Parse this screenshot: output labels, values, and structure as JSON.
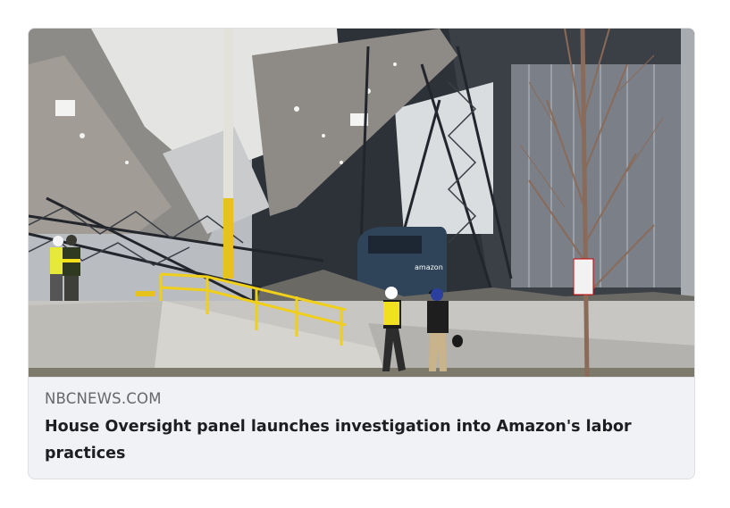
{
  "link_preview": {
    "domain": "NBCNEWS.COM",
    "headline": "House Oversight panel launches investigation into Amazon's labor practices",
    "image": {
      "alt": "Collapsed warehouse building with workers in safety vests walking past and a delivery van",
      "van_logo_text": "amazon"
    }
  }
}
